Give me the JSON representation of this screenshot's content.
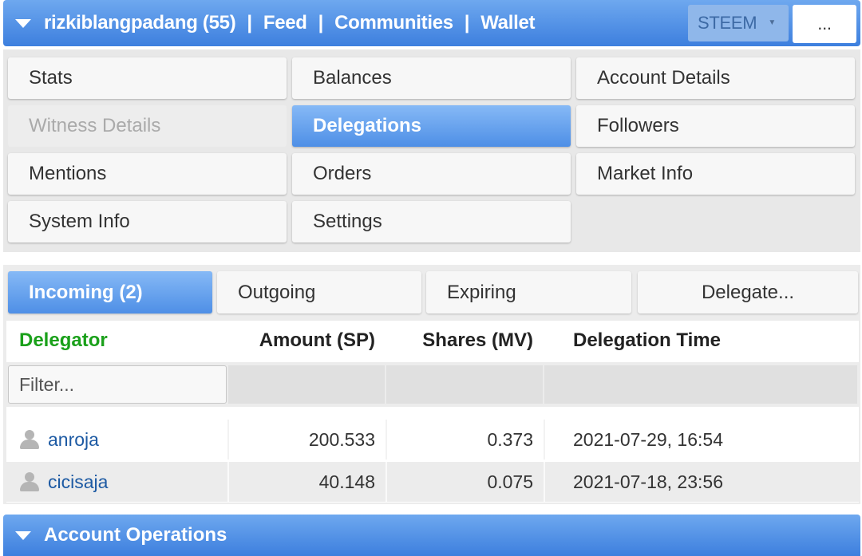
{
  "header": {
    "account": "rizkiblangpadang (55)",
    "separator": "|",
    "nav": [
      "Feed",
      "Communities",
      "Wallet"
    ],
    "currency": "STEEM",
    "more_label": "..."
  },
  "menu": {
    "items": [
      {
        "label": "Stats",
        "state": "normal"
      },
      {
        "label": "Balances",
        "state": "normal"
      },
      {
        "label": "Account Details",
        "state": "normal"
      },
      {
        "label": "Witness Details",
        "state": "disabled"
      },
      {
        "label": "Delegations",
        "state": "active"
      },
      {
        "label": "Followers",
        "state": "normal"
      },
      {
        "label": "Mentions",
        "state": "normal"
      },
      {
        "label": "Orders",
        "state": "normal"
      },
      {
        "label": "Market Info",
        "state": "normal"
      },
      {
        "label": "System Info",
        "state": "normal"
      },
      {
        "label": "Settings",
        "state": "normal"
      }
    ]
  },
  "delegations": {
    "tabs": [
      {
        "label": "Incoming (2)",
        "active": true
      },
      {
        "label": "Outgoing",
        "active": false
      },
      {
        "label": "Expiring",
        "active": false
      },
      {
        "label": "Delegate...",
        "active": false
      }
    ],
    "columns": [
      "Delegator",
      "Amount (SP)",
      "Shares (MV)",
      "Delegation Time"
    ],
    "filter_placeholder": "Filter...",
    "rows": [
      {
        "delegator": "anroja",
        "amount": "200.533",
        "shares": "0.373",
        "time": "2021-07-29, 16:54"
      },
      {
        "delegator": "cicisaja",
        "amount": "40.148",
        "shares": "0.075",
        "time": "2021-07-18, 23:56"
      }
    ]
  },
  "footer": {
    "title": "Account Operations"
  },
  "colors": {
    "header_blue": "#3d7fde",
    "active_blue": "#4e8fe6",
    "delegator_green": "#1aa01a",
    "link_blue": "#1d5aa3"
  }
}
